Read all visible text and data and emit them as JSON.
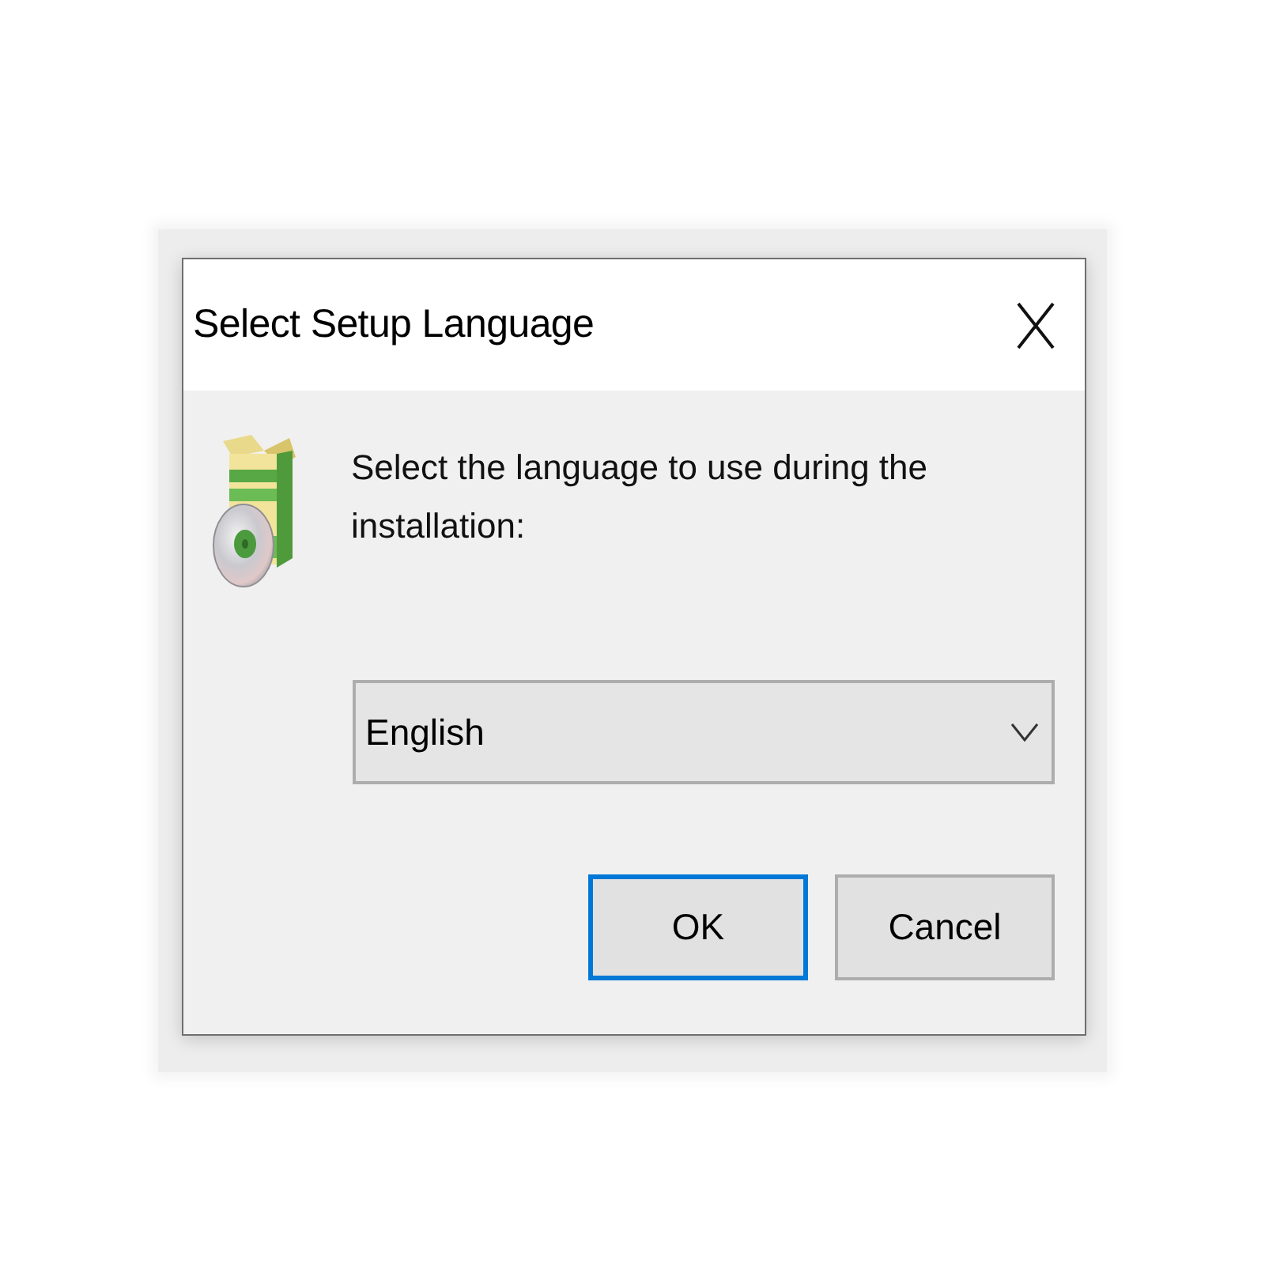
{
  "window": {
    "title": "Select Setup Language"
  },
  "message": "Select the language to use during the installation:",
  "language_dropdown": {
    "value": "English"
  },
  "buttons": [
    {
      "label": "OK",
      "default": true
    },
    {
      "label": "Cancel",
      "default": false
    }
  ]
}
